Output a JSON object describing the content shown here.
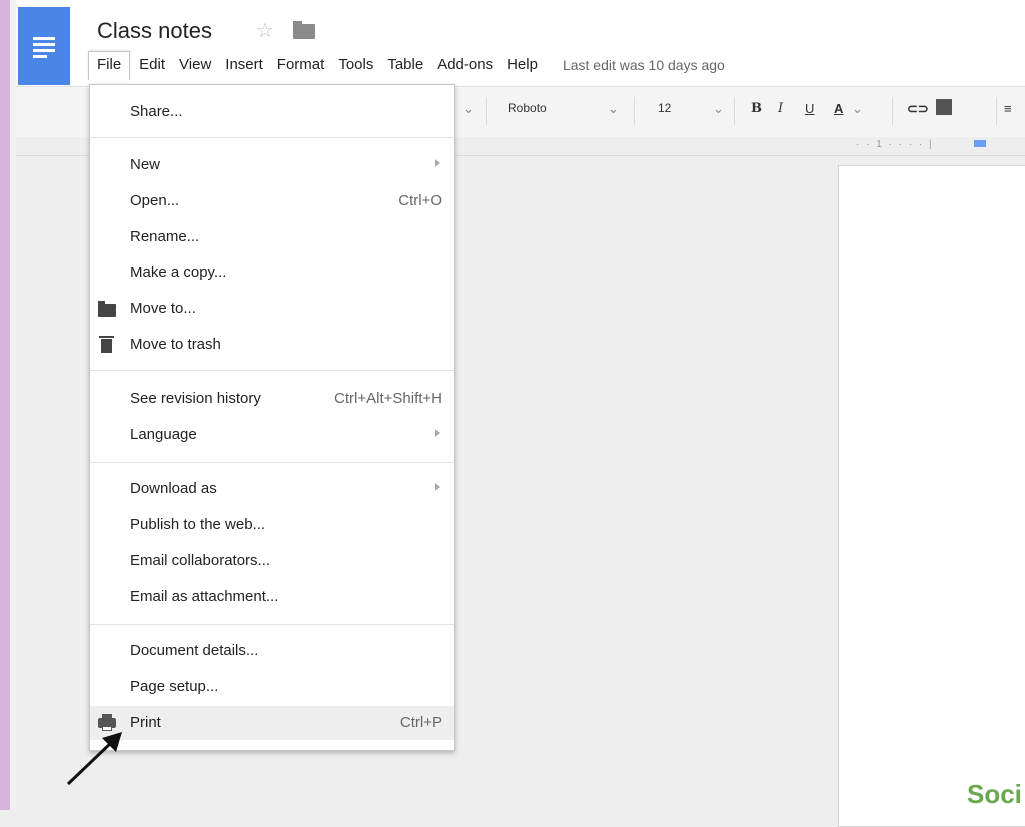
{
  "header": {
    "title": "Class notes",
    "last_edit": "Last edit was 10 days ago"
  },
  "menubar": [
    "File",
    "Edit",
    "View",
    "Insert",
    "Format",
    "Tools",
    "Table",
    "Add-ons",
    "Help"
  ],
  "toolbar": {
    "font": "Roboto",
    "size": "12",
    "bold": "B",
    "italic": "I",
    "underline": "U",
    "text_color": "A"
  },
  "ruler": {
    "marks": "· · 1 · · · · |"
  },
  "file_menu": {
    "share": "Share...",
    "new": "New",
    "open": "Open...",
    "open_shortcut": "Ctrl+O",
    "rename": "Rename...",
    "make_copy": "Make a copy...",
    "move_to": "Move to...",
    "move_to_trash": "Move to trash",
    "revision_history": "See revision history",
    "revision_shortcut": "Ctrl+Alt+Shift+H",
    "language": "Language",
    "download_as": "Download as",
    "publish": "Publish to the web...",
    "email_collaborators": "Email collaborators...",
    "email_attachment": "Email as attachment...",
    "document_details": "Document details...",
    "page_setup": "Page setup...",
    "print": "Print",
    "print_shortcut": "Ctrl+P"
  },
  "page": {
    "visible_text": "Soci"
  },
  "colors": {
    "docs_blue": "#4a86e8",
    "accent_green": "#6aa84f"
  }
}
